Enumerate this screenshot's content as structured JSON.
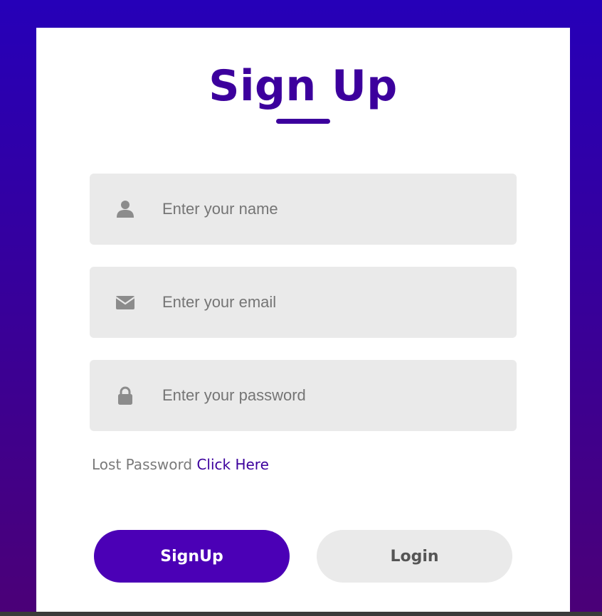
{
  "form": {
    "title": "Sign Up",
    "fields": [
      {
        "name": "name",
        "icon": "user-icon",
        "placeholder": "Enter your name",
        "value": ""
      },
      {
        "name": "email",
        "icon": "envelope-icon",
        "placeholder": "Enter your email",
        "value": ""
      },
      {
        "name": "password",
        "icon": "lock-icon",
        "placeholder": "Enter your password",
        "value": ""
      }
    ],
    "lost_password": {
      "prefix": "Lost Password",
      "link": "Click Here"
    },
    "buttons": {
      "signup": "SignUp",
      "login": "Login"
    }
  },
  "colors": {
    "accent": "#3c009d",
    "signup_button": "#4b00b6",
    "field_background": "#eaeaea",
    "background_top": "#2600b8",
    "background_bottom": "#4b0077"
  }
}
